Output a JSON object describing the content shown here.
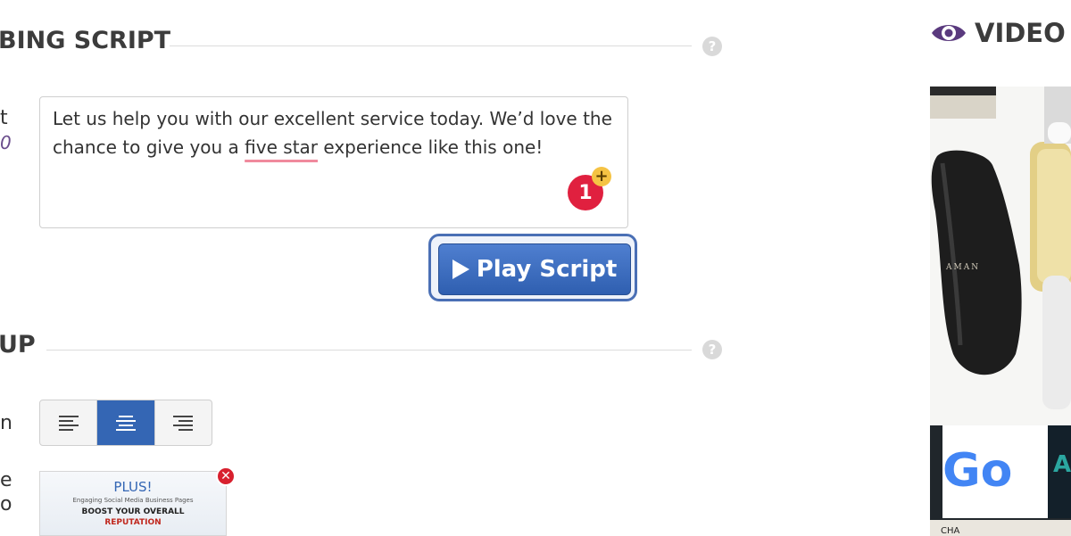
{
  "sections": {
    "script": {
      "title": "BING SCRIPT"
    },
    "setup": {
      "title": "UP"
    }
  },
  "help_glyph": "?",
  "script_side_label": "t",
  "script_side_counter": "0",
  "script": {
    "text_before": "Let us help you with our excellent service today. We’d love the chance to give you a ",
    "text_flagged": "five star",
    "text_after": " experience like this one!",
    "badge_count": "1",
    "badge_plus": "+"
  },
  "play_button": {
    "label": "Play Script"
  },
  "alignment": {
    "side_label": "n",
    "options": [
      "left",
      "center",
      "right"
    ],
    "selected": "center"
  },
  "logo": {
    "side_label_1": "e",
    "side_label_2": "o",
    "thumb_line1": "PLUS!",
    "thumb_line2": "Engaging Social Media Business Pages",
    "thumb_line3": "BOOST YOUR OVERALL",
    "thumb_line4": "REPUTATION",
    "remove_glyph": "✕"
  },
  "preview": {
    "title": "VIDEO P"
  },
  "video": {
    "product_text": "AMAN",
    "google_letters": "Go",
    "overlay_letter": "A",
    "bottom_text": "CHA"
  },
  "colors": {
    "accent": "#3466b4",
    "badge": "#e0203f",
    "icon_purple": "#5a3a7e"
  }
}
